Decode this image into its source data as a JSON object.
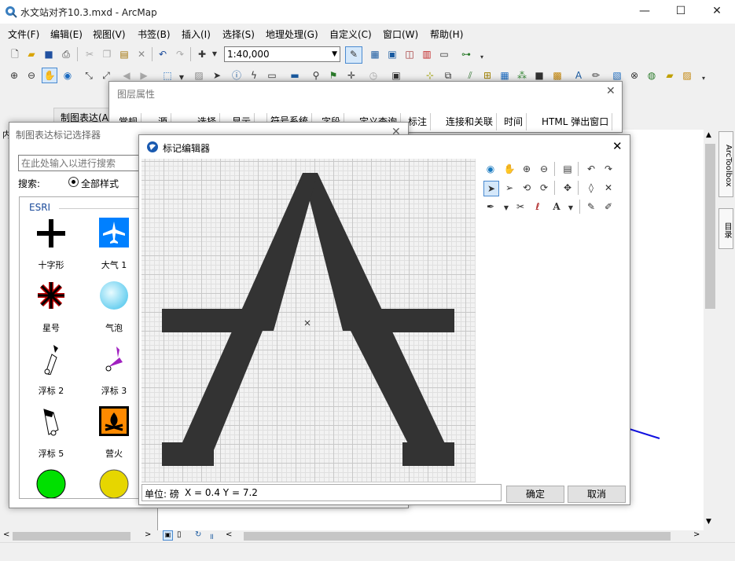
{
  "window": {
    "title": "水文站对齐10.3.mxd - ArcMap",
    "minimize": "—",
    "maximize": "☐",
    "close": "✕"
  },
  "menu": [
    "文件(F)",
    "编辑(E)",
    "视图(V)",
    "书签(B)",
    "插入(I)",
    "选择(S)",
    "地理处理(G)",
    "自定义(C)",
    "窗口(W)",
    "帮助(H)"
  ],
  "toolbar": {
    "scale_value": "1:40,000"
  },
  "left_panel": {
    "tab_label": "内",
    "toc_title": "制图表达(A)"
  },
  "layer_properties": {
    "title": "图层属性",
    "tabs": [
      "常规",
      "源",
      "选择",
      "显示",
      "符号系统",
      "字段",
      "定义查询",
      "标注",
      "连接和关联",
      "时间",
      "HTML 弹出窗口"
    ]
  },
  "marker_selector": {
    "title": "制图表达标记选择器",
    "search_placeholder": "在此处输入以进行搜索",
    "search_label": "搜索:",
    "scope_option": "全部样式",
    "group_label": "ESRI",
    "symbols": [
      "十字形",
      "大气 1",
      "星号",
      "气泡",
      "浮标 2",
      "浮标 3",
      "浮标 5",
      "营火",
      "",
      ""
    ]
  },
  "marker_editor": {
    "title": "标记编辑器",
    "units_label": "单位: 磅",
    "coords": "X = 0.4   Y = 7.2",
    "ok_label": "确定",
    "cancel_label": "取消",
    "glyph_color": "#333333"
  },
  "right_dock": {
    "tabs": [
      "ArcToolbox",
      "目录"
    ]
  },
  "colors": {
    "accent": "#0078d7",
    "map_line": "#1010e0"
  }
}
